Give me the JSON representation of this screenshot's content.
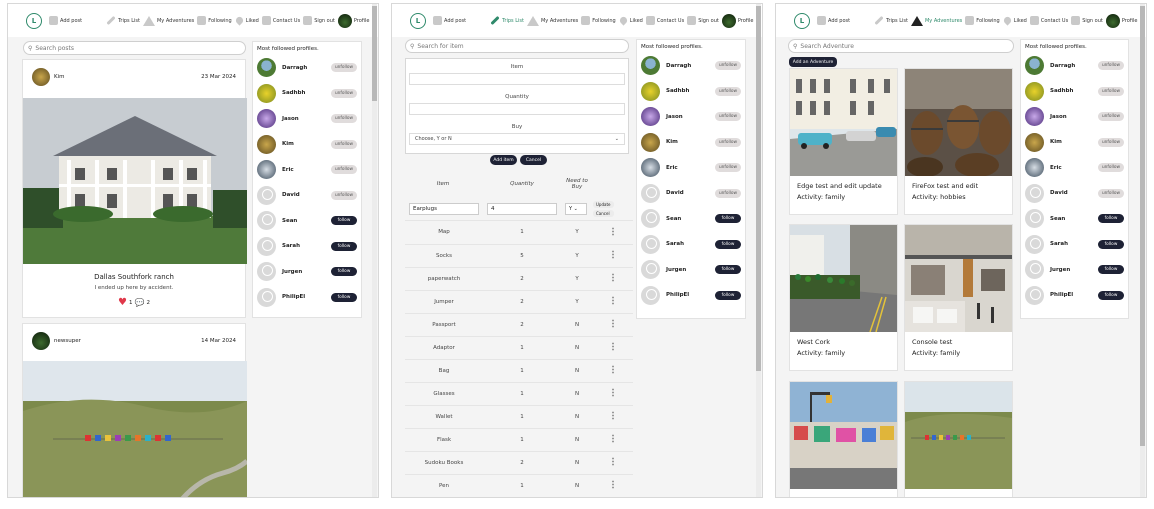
{
  "nav": {
    "logo": "L",
    "add_post": "Add post",
    "trips_list": "Trips List",
    "my_adventures": "My Adventures",
    "following": "Following",
    "liked": "Liked",
    "contact_us": "Contact Us",
    "sign_out": "Sign out",
    "profile": "Profile"
  },
  "colors": {
    "accent": "#2f8a6b",
    "follow_btn": "#1e2235",
    "unfollow_btn": "#e0dcdc"
  },
  "sidebar": {
    "title": "Most followed profiles.",
    "profiles": [
      {
        "name": "Darragh",
        "action": "unfollow"
      },
      {
        "name": "Sadhbh",
        "action": "unfollow"
      },
      {
        "name": "Jason",
        "action": "unfollow"
      },
      {
        "name": "Kim",
        "action": "unfollow"
      },
      {
        "name": "Eric",
        "action": "unfollow"
      },
      {
        "name": "David",
        "action": "unfollow"
      },
      {
        "name": "Sean",
        "action": "follow"
      },
      {
        "name": "Sarah",
        "action": "follow"
      },
      {
        "name": "Jurgen",
        "action": "follow"
      },
      {
        "name": "PhilipEl",
        "action": "follow"
      }
    ]
  },
  "feed": {
    "search_placeholder": "Search posts",
    "posts": [
      {
        "author": "Kim",
        "date": "23 Mar 2024",
        "title": "Dallas Southfork ranch",
        "caption": "I ended up here by accident.",
        "likes": "1",
        "comments": "2"
      },
      {
        "author": "newsuper",
        "date": "14 Mar 2024"
      }
    ]
  },
  "trips": {
    "search_placeholder": "Search for item",
    "form": {
      "item_label": "Item",
      "quantity_label": "Quantity",
      "buy_label": "Buy",
      "buy_placeholder": "Choose, Y or N",
      "add_button": "Add item",
      "cancel_button": "Cancel"
    },
    "headers": [
      "Item",
      "Quantity",
      "Need to Buy"
    ],
    "edit_row": {
      "item": "Earplugs",
      "quantity": "4",
      "buy": "Y",
      "update": "Update",
      "cancel": "Cancel"
    },
    "rows": [
      {
        "item": "Map",
        "qty": "1",
        "buy": "Y"
      },
      {
        "item": "Socks",
        "qty": "5",
        "buy": "Y"
      },
      {
        "item": "paperwatch",
        "qty": "2",
        "buy": "Y"
      },
      {
        "item": "Jumper",
        "qty": "2",
        "buy": "Y"
      },
      {
        "item": "Passport",
        "qty": "2",
        "buy": "N"
      },
      {
        "item": "Adaptor",
        "qty": "1",
        "buy": "N"
      },
      {
        "item": "Bag",
        "qty": "1",
        "buy": "N"
      },
      {
        "item": "Glasses",
        "qty": "1",
        "buy": "N"
      },
      {
        "item": "Wallet",
        "qty": "1",
        "buy": "N"
      },
      {
        "item": "Flask",
        "qty": "1",
        "buy": "N"
      },
      {
        "item": "Sudoku Books",
        "qty": "2",
        "buy": "N"
      },
      {
        "item": "Pen",
        "qty": "1",
        "buy": "N"
      }
    ]
  },
  "adventures": {
    "search_placeholder": "Search Adventure",
    "add_button": "Add an Adventure",
    "cards": [
      {
        "title": "Edge test and edit update",
        "activity": "Activity: family"
      },
      {
        "title": "FireFox test and edit",
        "activity": "Activity: hobbies"
      },
      {
        "title": "West Cork",
        "activity": "Activity: family"
      },
      {
        "title": "Console test",
        "activity": "Activity: family"
      }
    ]
  }
}
